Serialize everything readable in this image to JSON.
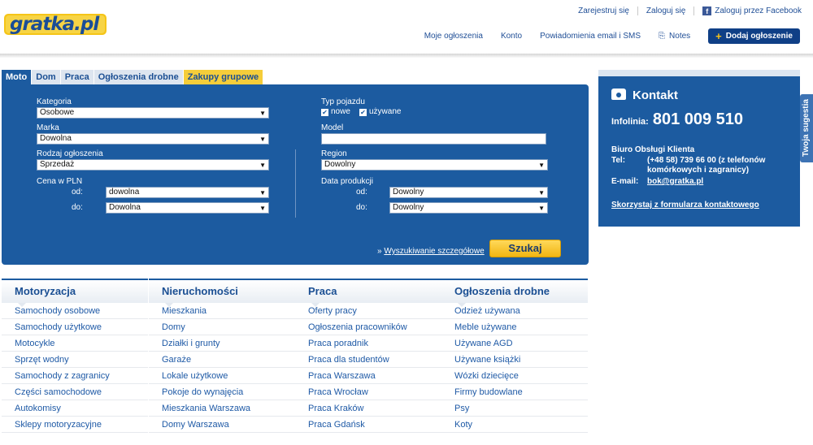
{
  "header": {
    "logo_text": "gratka.pl",
    "top_links": {
      "register": "Zarejestruj się",
      "login": "Zaloguj się",
      "facebook": "Zaloguj przez Facebook"
    },
    "nav": {
      "my_ads": "Moje ogłoszenia",
      "account": "Konto",
      "notifications": "Powiadomienia email i SMS",
      "notes": "Notes"
    },
    "add_button": "Dodaj ogłoszenie"
  },
  "tabs": [
    "Moto",
    "Dom",
    "Praca",
    "Ogłoszenia drobne",
    "Zakupy grupowe"
  ],
  "search": {
    "kategoria_label": "Kategoria",
    "kategoria_value": "Osobowe",
    "marka_label": "Marka",
    "marka_value": "Dowolna",
    "rodzaj_label": "Rodzaj ogłoszenia",
    "rodzaj_value": "Sprzedaż",
    "cena_label": "Cena w PLN",
    "od_label": "od:",
    "do_label": "do:",
    "cena_od_value": "dowolna",
    "cena_do_value": "Dowolna",
    "typ_label": "Typ pojazdu",
    "nowe_label": "nowe",
    "uzywane_label": "używane",
    "model_label": "Model",
    "region_label": "Region",
    "region_value": "Dowolny",
    "data_label": "Data produkcji",
    "data_od_value": "Dowolny",
    "data_do_value": "Dowolny",
    "advanced_prefix": "»",
    "advanced_link": "Wyszukiwanie szczegółowe",
    "submit": "Szukaj"
  },
  "kontakt": {
    "title": "Kontakt",
    "infolinia_label": "Infolinia:",
    "infolinia_number": "801 009 510",
    "biuro": "Biuro Obsługi Klienta",
    "tel_label": "Tel:",
    "tel_value": "(+48 58) 739 66 00 (z telefonów komórkowych i zagranicy)",
    "email_label": "E-mail:",
    "email_value": "bok@gratka.pl",
    "form_link": "Skorzystaj z formularza kontaktowego"
  },
  "side_tab": "Twoja sugestia",
  "categories": [
    {
      "title": "Motoryzacja",
      "items": [
        "Samochody osobowe",
        "Samochody użytkowe",
        "Motocykle",
        "Sprzęt wodny",
        "Samochody z zagranicy",
        "Części samochodowe",
        "Autokomisy",
        "Sklepy motoryzacyjne"
      ]
    },
    {
      "title": "Nieruchomości",
      "items": [
        "Mieszkania",
        "Domy",
        "Działki i grunty",
        "Garaże",
        "Lokale użytkowe",
        "Pokoje do wynajęcia",
        "Mieszkania Warszawa",
        "Domy Warszawa"
      ]
    },
    {
      "title": "Praca",
      "items": [
        "Oferty pracy",
        "Ogłoszenia pracowników",
        "Praca poradnik",
        "Praca dla studentów",
        "Praca Warszawa",
        "Praca Wrocław",
        "Praca Kraków",
        "Praca Gdańsk"
      ]
    },
    {
      "title": "Ogłoszenia drobne",
      "items": [
        "Odzież używana",
        "Meble używane",
        "Używane AGD",
        "Używane książki",
        "Wózki dziecięce",
        "Firmy budowlane",
        "Psy",
        "Koty"
      ]
    }
  ]
}
